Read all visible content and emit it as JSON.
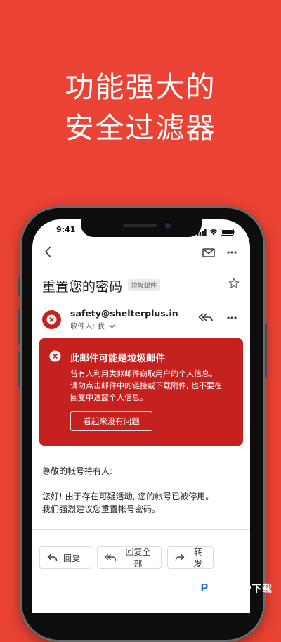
{
  "headline": {
    "line1": "功能强大的",
    "line2": "安全过滤器"
  },
  "status_bar": {
    "time": "9:41"
  },
  "toolbar": {
    "back_icon": "chevron-left-icon",
    "mail_icon": "mail-icon",
    "more_icon": "more-horizontal-icon"
  },
  "email": {
    "subject": "重置您的密码",
    "label": "垃圾邮件",
    "sender": "safety@shelterplus.in",
    "recipient": "收件人: 我",
    "warning": {
      "title": "此邮件可能是垃圾邮件",
      "body_line1": "曾有人利用类似邮件窃取用户的个人信息。",
      "body_line2": "请勿点击邮件中的链接或下载附件, 也不要在",
      "body_line3": "回复中透露个人信息。",
      "button": "看起来没有问题"
    },
    "greeting": "尊敬的帐号持有人:",
    "body_line1": "您好! 由于存在可疑活动, 您的帐号已被停用。",
    "body_line2": "我们强烈建议您重置帐号密码。"
  },
  "actions": {
    "reply": "回复",
    "reply_all": "回复全部",
    "forward": "转发"
  },
  "watermark": {
    "logo_letter": "P",
    "text": "PCPOP下载"
  },
  "colors": {
    "background": "#ea4335",
    "warning": "#c5221f"
  }
}
